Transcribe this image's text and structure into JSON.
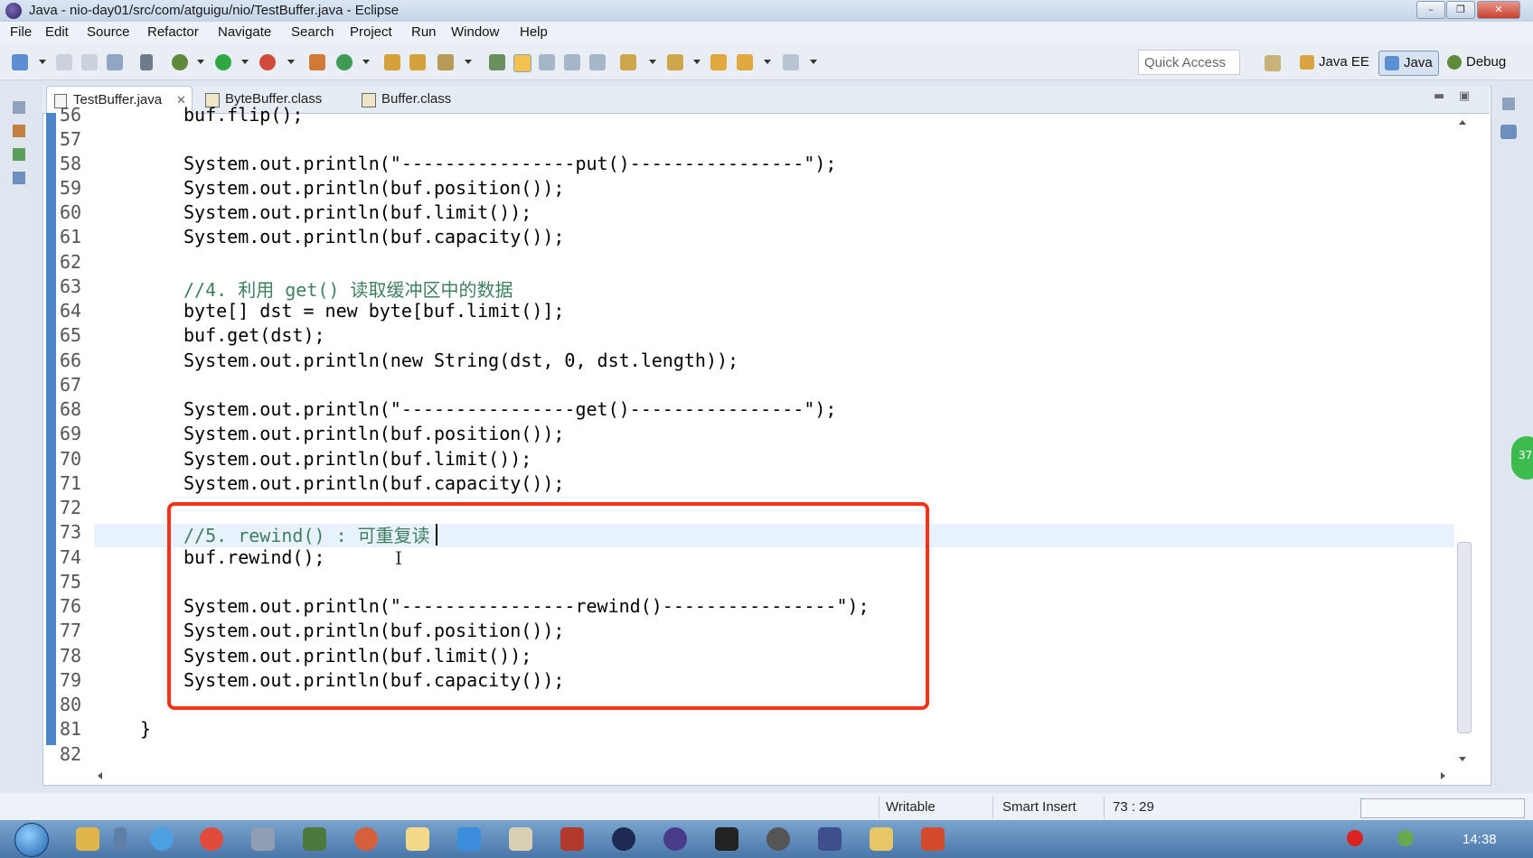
{
  "window": {
    "title": "Java - nio-day01/src/com/atguigu/nio/TestBuffer.java - Eclipse"
  },
  "menu": [
    "File",
    "Edit",
    "Source",
    "Refactor",
    "Navigate",
    "Search",
    "Project",
    "Run",
    "Window",
    "Help"
  ],
  "toolbar": {
    "quick_access": "Quick Access"
  },
  "perspectives": [
    "Java EE",
    "Java",
    "Debug"
  ],
  "tabs": [
    "TestBuffer.java",
    "ByteBuffer.class",
    "Buffer.class"
  ],
  "code": {
    "lines": [
      {
        "n": "56",
        "text": "buf.flip();"
      },
      {
        "n": "57",
        "text": ""
      },
      {
        "n": "58",
        "text": "System.out.println(\"----------------put()----------------\");"
      },
      {
        "n": "59",
        "text": "System.out.println(buf.position());"
      },
      {
        "n": "60",
        "text": "System.out.println(buf.limit());"
      },
      {
        "n": "61",
        "text": "System.out.println(buf.capacity());"
      },
      {
        "n": "62",
        "text": ""
      },
      {
        "n": "63",
        "text": "//4. 利用 get() 读取缓冲区中的数据"
      },
      {
        "n": "64",
        "text": "byte[] dst = new byte[buf.limit()];"
      },
      {
        "n": "65",
        "text": "buf.get(dst);"
      },
      {
        "n": "66",
        "text": "System.out.println(new String(dst, 0, dst.length));"
      },
      {
        "n": "67",
        "text": ""
      },
      {
        "n": "68",
        "text": "System.out.println(\"----------------get()----------------\");"
      },
      {
        "n": "69",
        "text": "System.out.println(buf.position());"
      },
      {
        "n": "70",
        "text": "System.out.println(buf.limit());"
      },
      {
        "n": "71",
        "text": "System.out.println(buf.capacity());"
      },
      {
        "n": "72",
        "text": ""
      },
      {
        "n": "73",
        "text": "//5. rewind() : 可重复读"
      },
      {
        "n": "74",
        "text": "buf.rewind();"
      },
      {
        "n": "75",
        "text": ""
      },
      {
        "n": "76",
        "text": "System.out.println(\"----------------rewind()----------------\");"
      },
      {
        "n": "77",
        "text": "System.out.println(buf.position());"
      },
      {
        "n": "78",
        "text": "System.out.println(buf.limit());"
      },
      {
        "n": "79",
        "text": "System.out.println(buf.capacity());"
      },
      {
        "n": "80",
        "text": ""
      },
      {
        "n": "81",
        "text": "}"
      },
      {
        "n": "82",
        "text": ""
      }
    ]
  },
  "status": {
    "writable": "Writable",
    "insert_mode": "Smart Insert",
    "position": "73 : 29"
  },
  "taskbar": {
    "clock": "14:38",
    "badge": "37"
  },
  "colors": {
    "highlight_box": "#f0331a",
    "ruler": "#4a86c8",
    "keyword": "#7f0055",
    "string": "#2a00ff",
    "comment": "#3f7f5f"
  }
}
